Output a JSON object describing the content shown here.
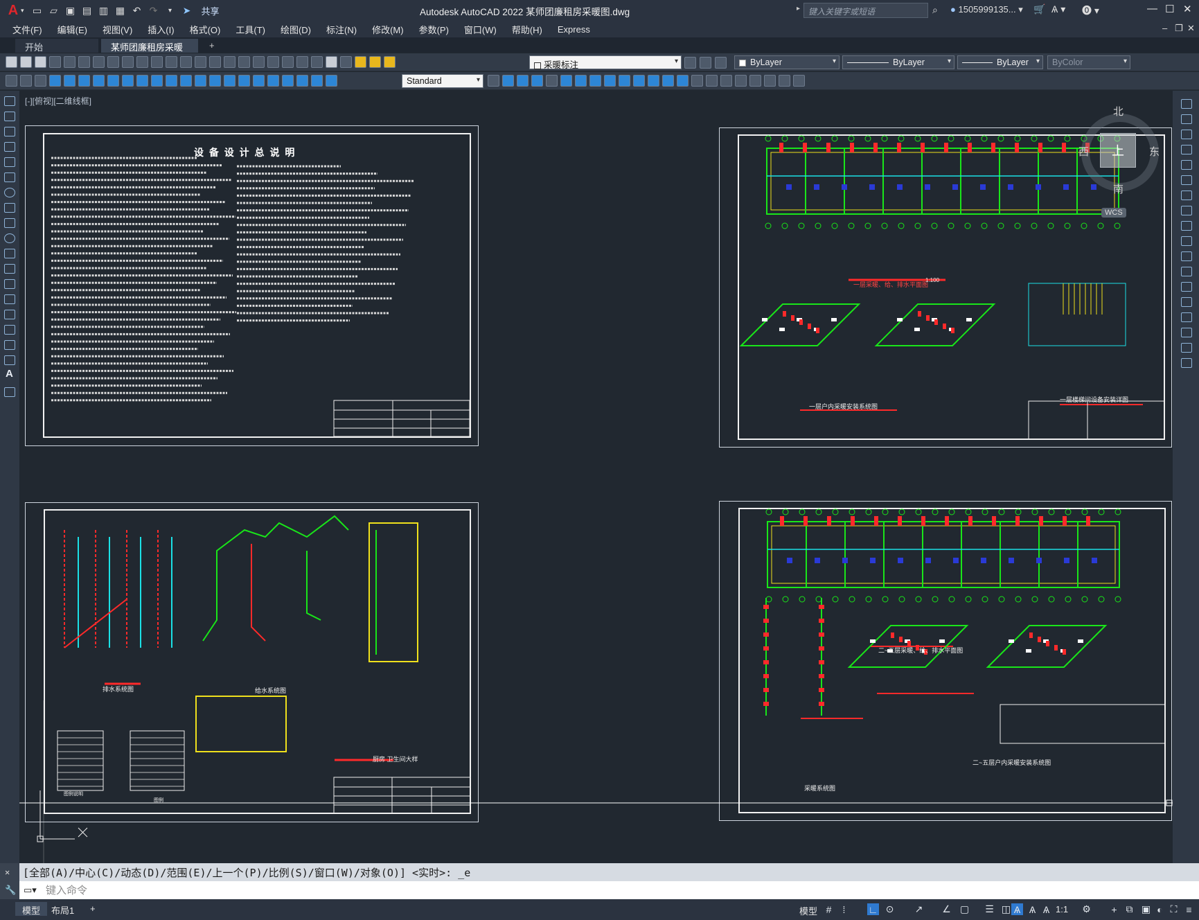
{
  "title_bar": {
    "app_logo": "A",
    "share_label": "共享",
    "title": "Autodesk AutoCAD 2022    某师团廉租房采暖图.dwg",
    "search_placeholder": "键入关键字或短语",
    "user_name": "1505999135...",
    "icons": [
      "new-icon",
      "open-icon",
      "save-icon",
      "saveas-icon",
      "plot-icon",
      "print-icon",
      "undo-icon",
      "redo-icon",
      "share-icon",
      "search-icon",
      "user-icon",
      "cart-icon",
      "a360-icon",
      "help-icon"
    ]
  },
  "menu": {
    "items": [
      "文件(F)",
      "编辑(E)",
      "视图(V)",
      "插入(I)",
      "格式(O)",
      "工具(T)",
      "绘图(D)",
      "标注(N)",
      "修改(M)",
      "参数(P)",
      "窗口(W)",
      "帮助(H)",
      "Express"
    ]
  },
  "tabs": {
    "items": [
      {
        "label": "开始"
      },
      {
        "label": "某师团廉租房采暖图*"
      }
    ],
    "close_glyph": "✕",
    "add_glyph": "+"
  },
  "toolbar1": {
    "layer_name": "采暖标注",
    "color": "ByLayer",
    "linetype": "ByLayer",
    "lineweight": "ByLayer",
    "plotstyle": "ByColor"
  },
  "toolbar2": {
    "text_style": "Standard"
  },
  "viewport": {
    "label": "[-][俯视][二维线框]"
  },
  "viewcube": {
    "north": "北",
    "west": "西",
    "east": "东",
    "south": "南",
    "top": "上",
    "wcs": "WCS"
  },
  "sheets": {
    "a_title": "设  备  设  计  总  说  明",
    "b_caption_1": "一层采暖、给、排水平面图",
    "b_caption_2": "一层户内采暖安装系统图",
    "b_caption_3": "一层楼梯间设备安装详图",
    "b_scale": "1:100",
    "c_caption_1": "排水系统图",
    "c_caption_2": "给水系统图",
    "c_caption_3": "厨房  卫生间大样",
    "c_table_1": "图例说明",
    "c_table_2": "图例",
    "d_caption_1": "二~五层采暖、给、排水平面图",
    "d_caption_2": "二~五层户内采暖安装系统图",
    "d_caption_3": "采暖系统图"
  },
  "command": {
    "history": "[全部(A)/中心(C)/动态(D)/范围(E)/上一个(P)/比例(S)/窗口(W)/对象(O)] <实时>: _e",
    "input_placeholder": "键入命令"
  },
  "status": {
    "layouts": [
      "模型",
      "布局1"
    ],
    "add_layout": "+",
    "model_label": "模型",
    "scale": "1:1"
  },
  "colors": {
    "accent_red": "#ff2a2a",
    "cad_green": "#19e619",
    "cad_cyan": "#1be1e6",
    "cad_yellow": "#f0e11c",
    "canvas_bg": "#212830"
  }
}
